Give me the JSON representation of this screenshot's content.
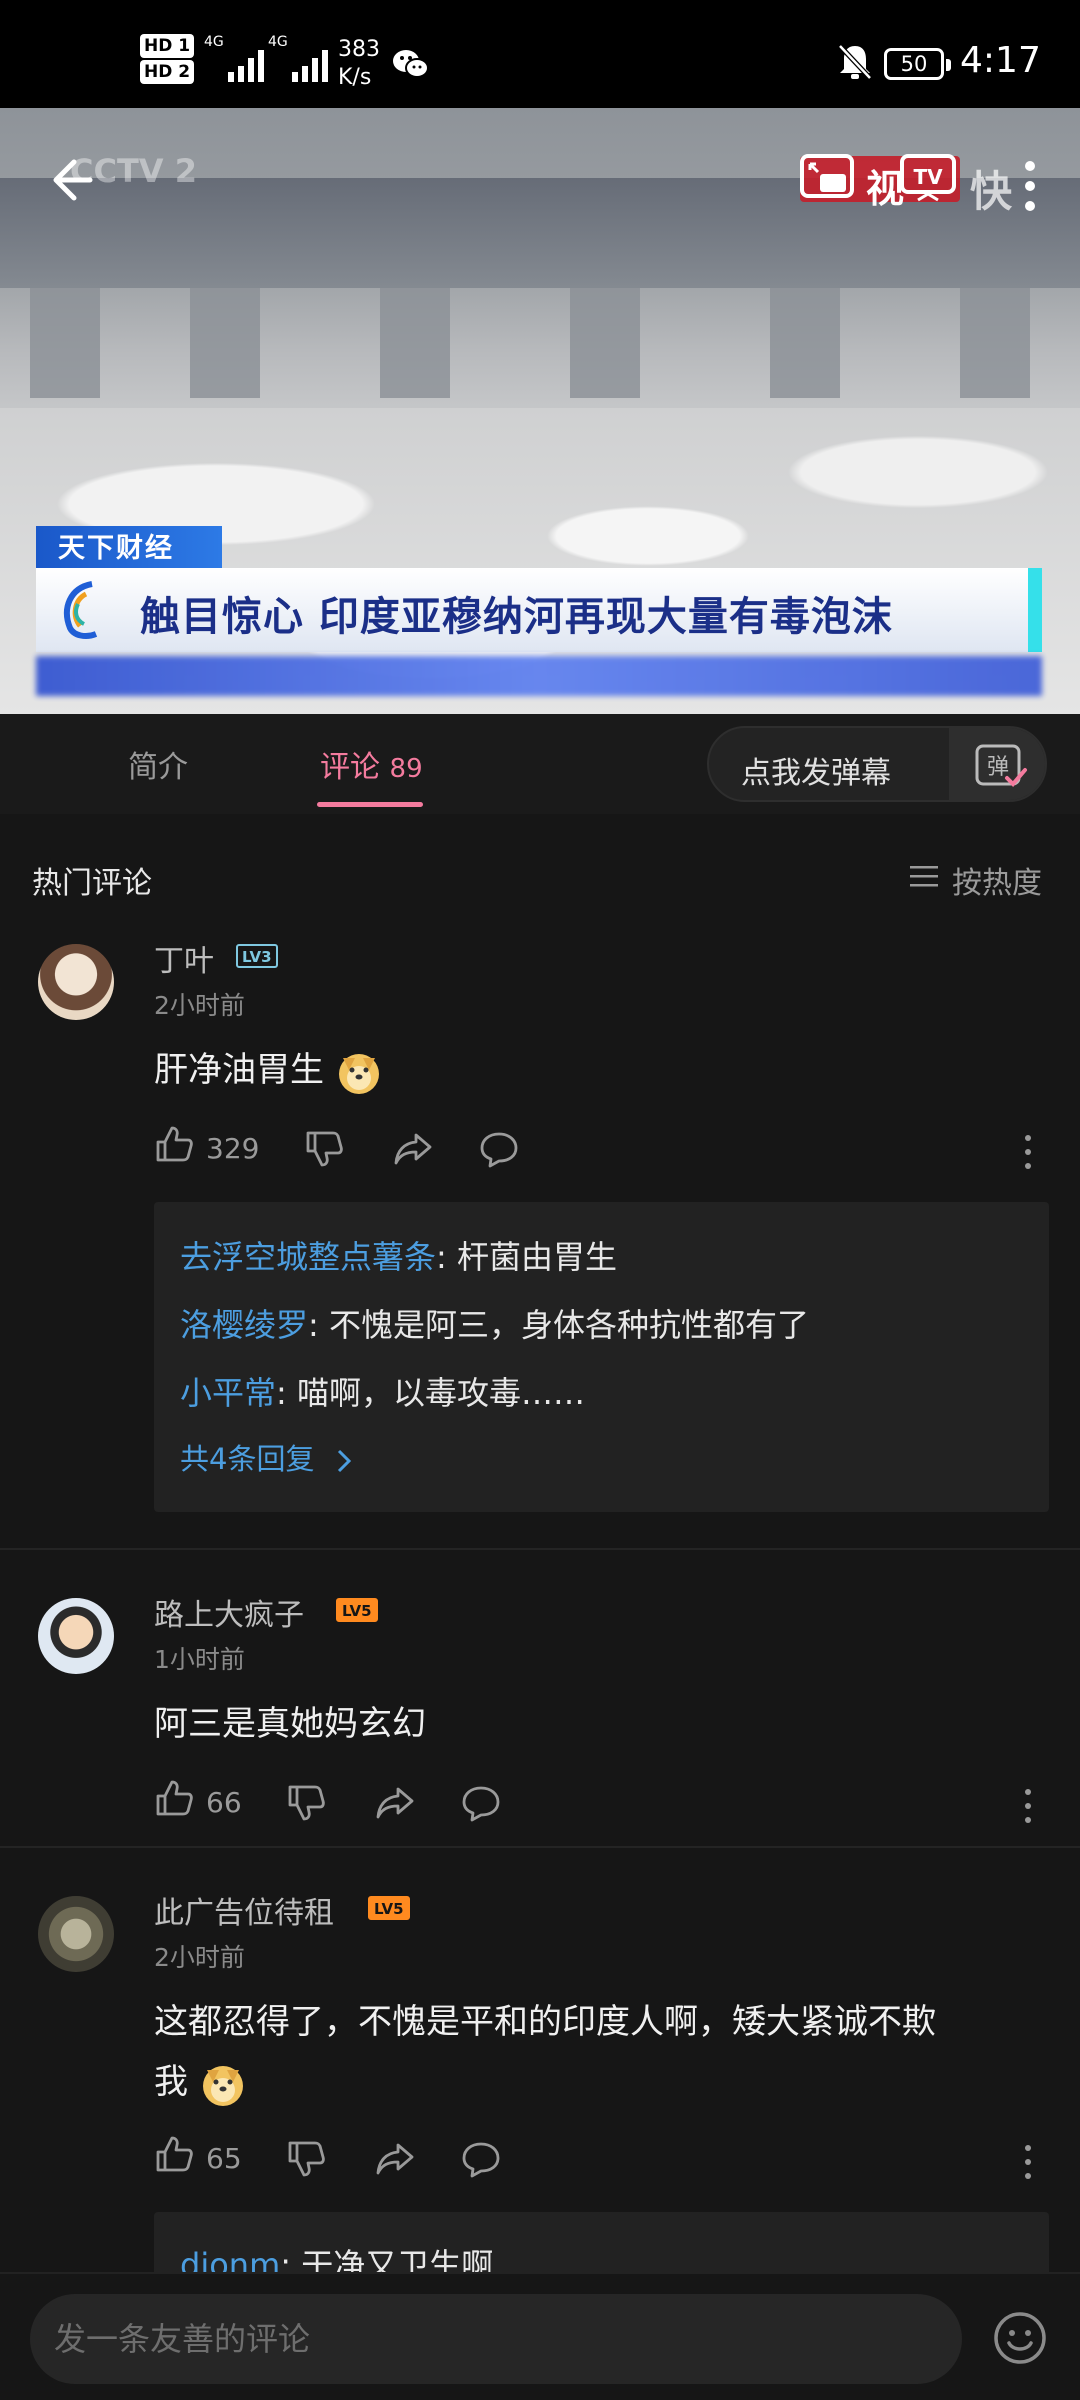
{
  "status_bar": {
    "hd1": "HD 1",
    "hd2": "HD 2",
    "net1": "4G",
    "net2": "4G",
    "speed_value": "383",
    "speed_unit": "K/s",
    "battery": "50",
    "time": "4:17"
  },
  "video": {
    "channel_logo": "CCTV 2",
    "watermark_text": "视",
    "watermark_brand": "快",
    "news_tag": "天下财经",
    "news_title": "触目惊心 印度亚穆纳河再现大量有毒泡沫"
  },
  "tabs": {
    "intro": "简介",
    "comments": "评论",
    "comments_count": "89",
    "danmu_button": "点我发弹幕"
  },
  "comments_section": {
    "title": "热门评论",
    "sort_label": "按热度"
  },
  "comments": [
    {
      "user": "丁叶",
      "level": "LV3",
      "time": "2小时前",
      "text": "肝净油胃生",
      "likes": "329",
      "replies": [
        {
          "who": "去浮空城整点薯条",
          "text": ": 杆菌由胃生"
        },
        {
          "who": "洛樱绫罗",
          "text": ": 不愧是阿三，身体各种抗性都有了"
        },
        {
          "who": "小平常",
          "text": ": 喵啊，以毒攻毒……"
        }
      ],
      "reply_more": "共4条回复"
    },
    {
      "user": "路上大疯子",
      "level": "LV5",
      "time": "1小时前",
      "text": "阿三是真她妈玄幻",
      "likes": "66"
    },
    {
      "user": "此广告位待租",
      "level": "LV5",
      "time": "2小时前",
      "text_line1": "这都忍得了，不愧是平和的印度人啊，矮大紧诚不欺",
      "text_line2": "我",
      "likes": "65",
      "replies": [
        {
          "who": "djonm",
          "text": ": 干净又卫生啊"
        }
      ]
    }
  ],
  "bottom": {
    "input_placeholder": "发一条友善的评论"
  },
  "colors": {
    "accent": "#f47b9e",
    "link": "#4c9ee0",
    "background": "#161616"
  }
}
